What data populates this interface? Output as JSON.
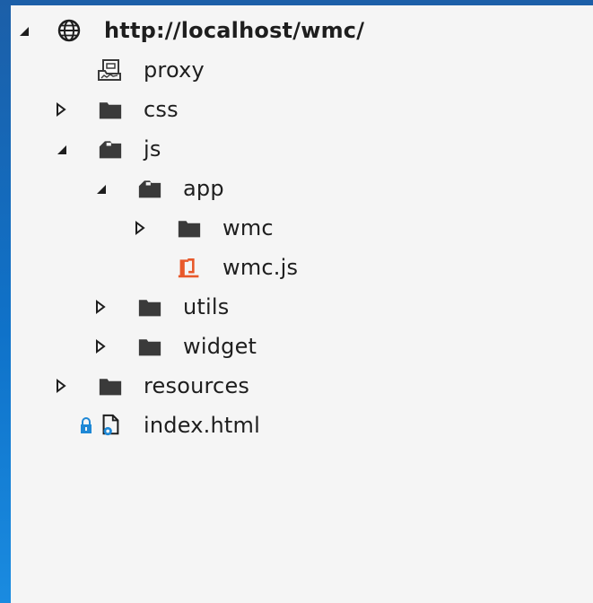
{
  "tree": {
    "root": {
      "label": "http://localhost/wmc/",
      "icon": "globe-icon",
      "expanded": true
    },
    "items": [
      {
        "label": "proxy",
        "icon": "web-folder-icon"
      },
      {
        "label": "css",
        "icon": "folder-icon",
        "expanded": false
      },
      {
        "label": "js",
        "icon": "folder-open-icon",
        "expanded": true
      },
      {
        "label": "app",
        "icon": "folder-open-icon",
        "expanded": true
      },
      {
        "label": "wmc",
        "icon": "folder-icon",
        "expanded": false
      },
      {
        "label": "wmc.js",
        "icon": "js-file-icon"
      },
      {
        "label": "utils",
        "icon": "folder-icon",
        "expanded": false
      },
      {
        "label": "widget",
        "icon": "folder-icon",
        "expanded": false
      },
      {
        "label": "resources",
        "icon": "folder-icon",
        "expanded": false
      },
      {
        "label": "index.html",
        "icon": "html-file-icon",
        "locked": true
      }
    ]
  },
  "colors": {
    "background": "#f5f5f5",
    "folder": "#3a3a3a",
    "js_accent": "#e8582a",
    "lock_accent": "#1e88d6",
    "text": "#1e1e1e"
  }
}
